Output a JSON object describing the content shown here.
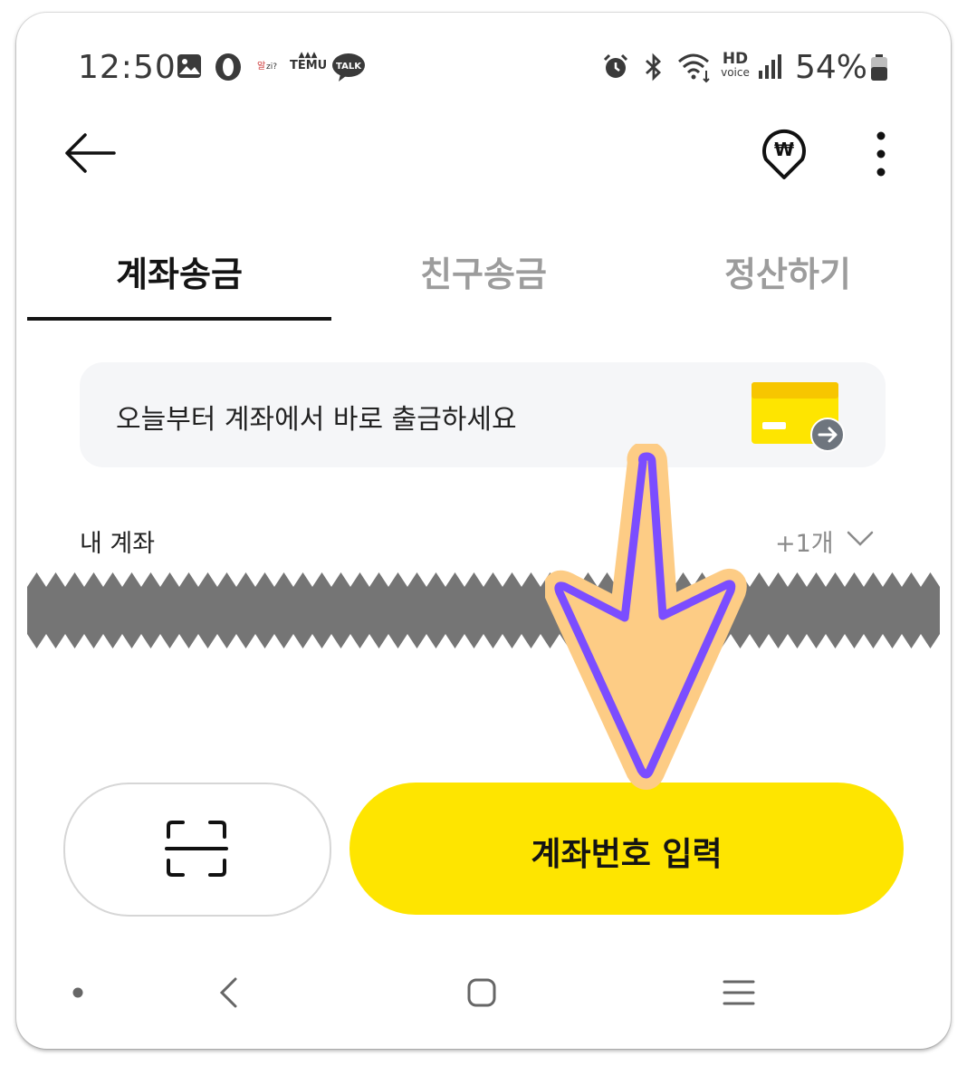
{
  "status_bar": {
    "time": "12:50",
    "notification_icons": [
      "gallery-icon",
      "opera-icon",
      "algi-app-icon",
      "temu-app-icon",
      "kakaotalk-icon"
    ],
    "kakao_label": "TALK",
    "temu_label": "TEMU",
    "system_icons": [
      "alarm-icon",
      "bluetooth-icon",
      "wifi-icon",
      "hd-voice-icon",
      "signal-icon",
      "battery-icon"
    ],
    "hd_label": "HD",
    "voice_label": "voice",
    "battery_percent": "54%"
  },
  "app_bar": {
    "back_icon": "arrow-left-icon",
    "won_icon": "won-location-icon",
    "more_icon": "more-vertical-icon"
  },
  "tabs": [
    {
      "label": "계좌송금",
      "active": true
    },
    {
      "label": "친구송금",
      "active": false
    },
    {
      "label": "정산하기",
      "active": false
    }
  ],
  "banner": {
    "text": "오늘부터 계좌에서 바로 출금하세요"
  },
  "accounts": {
    "label": "내 계좌",
    "more_count": "+1개"
  },
  "actions": {
    "scan_icon": "scan-frame-icon",
    "primary_label": "계좌번호 입력"
  },
  "nav_bar": {
    "items": [
      "recent-apps-dot",
      "back-icon",
      "home-icon",
      "menu-icon"
    ]
  },
  "colors": {
    "accent_yellow": "#fee500",
    "annotation_fill": "#fdcc85",
    "annotation_stroke": "#7b4dff"
  }
}
